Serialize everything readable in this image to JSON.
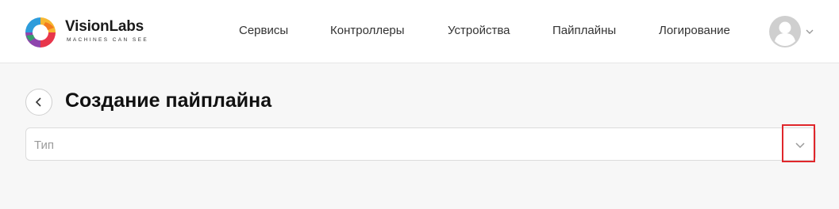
{
  "header": {
    "logo": {
      "name": "VisionLabs",
      "tagline": "MACHINES CAN SEE"
    },
    "nav": [
      {
        "label": "Сервисы"
      },
      {
        "label": "Контроллеры"
      },
      {
        "label": "Устройства"
      },
      {
        "label": "Пайплайны"
      },
      {
        "label": "Логирование"
      }
    ],
    "user_menu": {
      "avatar_icon": "user-avatar-icon",
      "chevron_icon": "chevron-down-icon"
    }
  },
  "page": {
    "back_icon": "chevron-left-icon",
    "title": "Создание пайплайна",
    "type_select": {
      "placeholder": "Тип",
      "toggle_icon": "chevron-down-icon",
      "highlight_color": "#e0262b"
    }
  }
}
